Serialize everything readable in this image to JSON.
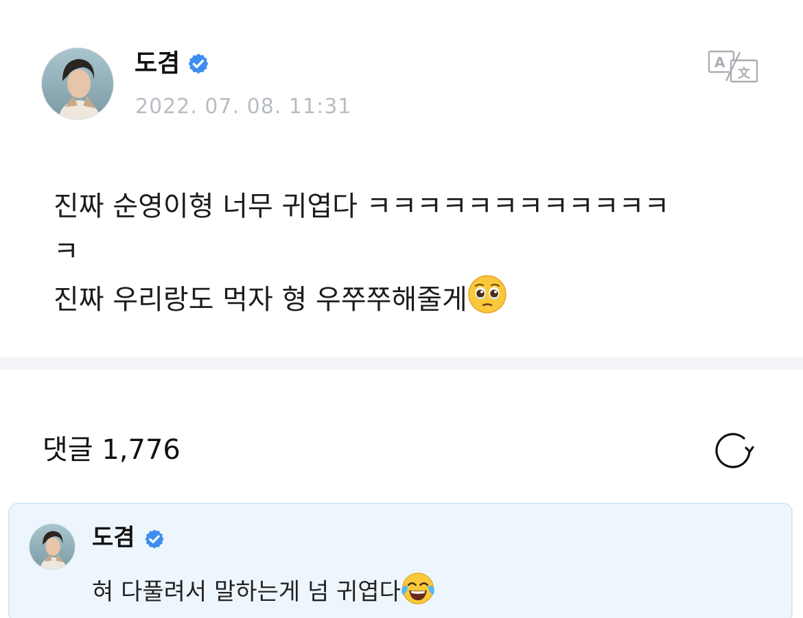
{
  "post": {
    "author": "도겸",
    "timestamp": "2022. 07. 08. 11:31",
    "body_lines": [
      "진짜 순영이형 너무 귀엽다 ㅋㅋㅋㅋㅋㅋㅋㅋㅋㅋㅋㅋ",
      "ㅋ",
      "진짜 우리랑도 먹자 형 우쭈쭈해줄게"
    ],
    "body_line3_emoji": "pleading-face",
    "translate_icon": "translate-icon"
  },
  "comments": {
    "label": "댓글",
    "count": "1,776",
    "refresh_icon": "refresh-icon"
  },
  "pinned_comment": {
    "author": "도겸",
    "text": "혀 다풀려서 말하는게 넘 귀엽다",
    "emoji": "tears-of-joy"
  },
  "colors": {
    "verified": "#3e8ef0",
    "timestamp": "#b8bcc3",
    "divider": "#f3f4f7",
    "comment_bg": "#eef6fd",
    "comment_border": "#d6e6f5",
    "icon_gray": "#a9adb3"
  }
}
